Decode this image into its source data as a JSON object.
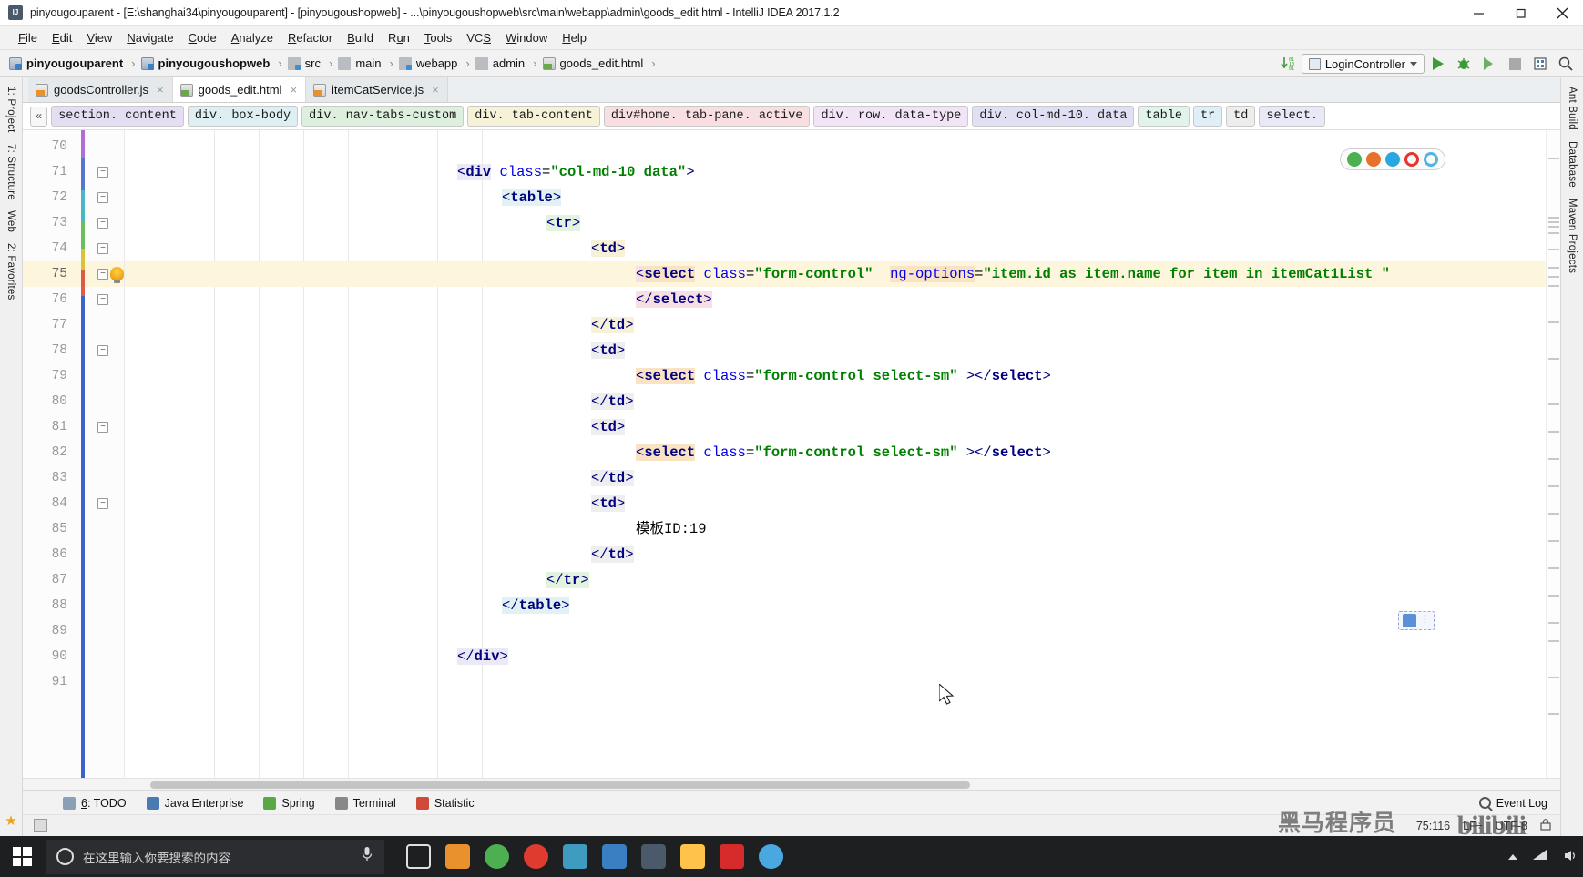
{
  "window": {
    "title": "pinyougouparent - [E:\\shanghai34\\pinyougouparent] - [pinyougoushopweb] - ...\\pinyougoushopweb\\src\\main\\webapp\\admin\\goods_edit.html - IntelliJ IDEA 2017.1.2",
    "app_icon": "intellij-idea-icon",
    "minimize_label": "─",
    "maximize_label": "❐",
    "close_label": "✕"
  },
  "menubar": {
    "items": [
      {
        "label": "File",
        "mnemonic": "F"
      },
      {
        "label": "Edit",
        "mnemonic": "E"
      },
      {
        "label": "View",
        "mnemonic": "V"
      },
      {
        "label": "Navigate",
        "mnemonic": "N"
      },
      {
        "label": "Code",
        "mnemonic": "C"
      },
      {
        "label": "Analyze",
        "mnemonic": "A"
      },
      {
        "label": "Refactor",
        "mnemonic": "R"
      },
      {
        "label": "Build",
        "mnemonic": "B"
      },
      {
        "label": "Run",
        "mnemonic": "u"
      },
      {
        "label": "Tools",
        "mnemonic": "T"
      },
      {
        "label": "VCS",
        "mnemonic": "S"
      },
      {
        "label": "Window",
        "mnemonic": "W"
      },
      {
        "label": "Help",
        "mnemonic": "H"
      }
    ]
  },
  "navbar": {
    "breadcrumbs": [
      {
        "label": "pinyougouparent",
        "icon": "module-icon",
        "bold": true
      },
      {
        "label": "pinyougoushopweb",
        "icon": "module-icon",
        "bold": true
      },
      {
        "label": "src",
        "icon": "source-folder-icon",
        "bold": false
      },
      {
        "label": "main",
        "icon": "folder-icon",
        "bold": false
      },
      {
        "label": "webapp",
        "icon": "web-folder-icon",
        "bold": false
      },
      {
        "label": "admin",
        "icon": "folder-icon",
        "bold": false
      },
      {
        "label": "goods_edit.html",
        "icon": "html-file-icon",
        "bold": false
      }
    ],
    "separator": "›",
    "run_config": "LoginController",
    "actions": [
      {
        "name": "update-project-icon",
        "label": "↓"
      },
      {
        "name": "run-button",
        "label": "Run"
      },
      {
        "name": "debug-button",
        "label": "Debug"
      },
      {
        "name": "run-coverage-button",
        "label": "Run with Coverage"
      },
      {
        "name": "stop-button",
        "label": "Stop"
      },
      {
        "name": "database-icon",
        "label": "Database"
      },
      {
        "name": "search-everywhere-icon",
        "label": "Search Everywhere"
      }
    ]
  },
  "editor_tabs": [
    {
      "label": "goodsController.js",
      "icon": "js-file-icon",
      "active": false,
      "close": "×"
    },
    {
      "label": "goods_edit.html",
      "icon": "html-file-icon",
      "active": true,
      "close": "×"
    },
    {
      "label": "itemCatService.js",
      "icon": "js-file-icon",
      "active": false,
      "close": "×"
    }
  ],
  "structure_breadcrumbs": {
    "collapse_label": "«",
    "chips": [
      {
        "label": "section. content",
        "color": "#e4def2"
      },
      {
        "label": "div. box-body",
        "color": "#ddeff2"
      },
      {
        "label": "div. nav-tabs-custom",
        "color": "#ddf0dd"
      },
      {
        "label": "div. tab-content",
        "color": "#f5f2d8"
      },
      {
        "label": "div#home. tab-pane. active",
        "color": "#f9dee2"
      },
      {
        "label": "div. row. data-type",
        "color": "#f2e4f7"
      },
      {
        "label": "div. col-md-10. data",
        "color": "#e0e0f4"
      },
      {
        "label": "table",
        "color": "#e1f4ec"
      },
      {
        "label": "tr",
        "color": "#dfeff7"
      },
      {
        "label": "td",
        "color": "#ededed"
      },
      {
        "label": "select.",
        "color": "#e8e8f6"
      }
    ]
  },
  "left_tool_strip": {
    "items": [
      {
        "label": "1: Project",
        "name": "tool-window-project"
      },
      {
        "label": "7: Structure",
        "name": "tool-window-structure"
      },
      {
        "label": "Web",
        "name": "tool-window-web"
      },
      {
        "label": "2: Favorites",
        "name": "tool-window-favorites"
      }
    ]
  },
  "right_tool_strip": {
    "items": [
      {
        "label": "Ant Build",
        "name": "tool-window-ant-build"
      },
      {
        "label": "Database",
        "name": "tool-window-database"
      },
      {
        "label": "Maven Projects",
        "name": "tool-window-maven-projects"
      }
    ]
  },
  "editor": {
    "first_line": 70,
    "highlighted_line": 75,
    "lines": [
      {
        "num": 70,
        "indent": 0,
        "tokens": []
      },
      {
        "num": 71,
        "indent": 0,
        "fold": "minus",
        "tokens": [
          {
            "t": "<",
            "c": "t-ang",
            "bg": "bg-f"
          },
          {
            "t": "div",
            "c": "t-tag",
            "bg": "bg-f"
          },
          {
            "t": " ",
            "c": "t-txt"
          },
          {
            "t": "class",
            "c": "t-attr"
          },
          {
            "t": "=",
            "c": "t-txt"
          },
          {
            "t": "\"col-md-10 data\"",
            "c": "t-val"
          },
          {
            "t": ">",
            "c": "t-ang"
          }
        ]
      },
      {
        "num": 72,
        "indent": 1,
        "fold": "minus",
        "tokens": [
          {
            "t": "<",
            "c": "t-ang",
            "bg": "bg-b"
          },
          {
            "t": "table",
            "c": "t-tag",
            "bg": "bg-b"
          },
          {
            "t": ">",
            "c": "t-ang",
            "bg": "bg-b"
          }
        ]
      },
      {
        "num": 73,
        "indent": 2,
        "fold": "minus",
        "tokens": [
          {
            "t": "<",
            "c": "t-ang",
            "bg": "bg-c"
          },
          {
            "t": "tr",
            "c": "t-tag",
            "bg": "bg-c"
          },
          {
            "t": ">",
            "c": "t-ang",
            "bg": "bg-c"
          }
        ]
      },
      {
        "num": 74,
        "indent": 3,
        "fold": "minus",
        "tokens": [
          {
            "t": "<",
            "c": "t-ang",
            "bg": "bg-d"
          },
          {
            "t": "td",
            "c": "t-tag",
            "bg": "bg-d"
          },
          {
            "t": ">",
            "c": "t-ang",
            "bg": "bg-d"
          }
        ]
      },
      {
        "num": 75,
        "indent": 4,
        "fold": "minus",
        "bulb": true,
        "tokens": [
          {
            "t": "<",
            "c": "t-ang",
            "bg": "bg-i"
          },
          {
            "t": "select",
            "c": "t-tag",
            "bg": "bg-h"
          },
          {
            "t": " ",
            "c": "t-txt"
          },
          {
            "t": "class",
            "c": "t-attr"
          },
          {
            "t": "=",
            "c": "t-txt"
          },
          {
            "t": "\"form-control\"",
            "c": "t-val"
          },
          {
            "t": "  ",
            "c": "t-txt"
          },
          {
            "t": "ng-options",
            "c": "t-attr",
            "bg": "bg-h"
          },
          {
            "t": "=",
            "c": "t-txt"
          },
          {
            "t": "\"item.id as item.name for item in itemCat1List \"",
            "c": "t-val"
          }
        ]
      },
      {
        "num": 76,
        "indent": 4,
        "fold": "minus",
        "tokens": [
          {
            "t": "</",
            "c": "t-ang",
            "bg": "bg-i"
          },
          {
            "t": "select",
            "c": "t-tag",
            "bg": "bg-i"
          },
          {
            "t": ">",
            "c": "t-ang",
            "bg": "bg-i"
          }
        ]
      },
      {
        "num": 77,
        "indent": 3,
        "tokens": [
          {
            "t": "</",
            "c": "t-ang",
            "bg": "bg-d"
          },
          {
            "t": "td",
            "c": "t-tag",
            "bg": "bg-d"
          },
          {
            "t": ">",
            "c": "t-ang",
            "bg": "bg-d"
          }
        ]
      },
      {
        "num": 78,
        "indent": 3,
        "fold": "minus",
        "tokens": [
          {
            "t": "<",
            "c": "t-ang",
            "bg": "bg-g"
          },
          {
            "t": "td",
            "c": "t-tag",
            "bg": "bg-g"
          },
          {
            "t": ">",
            "c": "t-ang",
            "bg": "bg-g"
          }
        ]
      },
      {
        "num": 79,
        "indent": 4,
        "tokens": [
          {
            "t": "<",
            "c": "t-ang",
            "bg": "bg-h"
          },
          {
            "t": "select",
            "c": "t-tag",
            "bg": "bg-h"
          },
          {
            "t": " ",
            "c": "t-txt"
          },
          {
            "t": "class",
            "c": "t-attr"
          },
          {
            "t": "=",
            "c": "t-txt"
          },
          {
            "t": "\"form-control select-sm\"",
            "c": "t-val"
          },
          {
            "t": " >",
            "c": "t-ang"
          },
          {
            "t": "</",
            "c": "t-ang"
          },
          {
            "t": "select",
            "c": "t-tag"
          },
          {
            "t": ">",
            "c": "t-ang"
          }
        ]
      },
      {
        "num": 80,
        "indent": 3,
        "tokens": [
          {
            "t": "</",
            "c": "t-ang",
            "bg": "bg-g"
          },
          {
            "t": "td",
            "c": "t-tag",
            "bg": "bg-g"
          },
          {
            "t": ">",
            "c": "t-ang",
            "bg": "bg-g"
          }
        ]
      },
      {
        "num": 81,
        "indent": 3,
        "fold": "minus",
        "tokens": [
          {
            "t": "<",
            "c": "t-ang",
            "bg": "bg-g"
          },
          {
            "t": "td",
            "c": "t-tag",
            "bg": "bg-g"
          },
          {
            "t": ">",
            "c": "t-ang",
            "bg": "bg-g"
          }
        ]
      },
      {
        "num": 82,
        "indent": 4,
        "tokens": [
          {
            "t": "<",
            "c": "t-ang",
            "bg": "bg-h"
          },
          {
            "t": "select",
            "c": "t-tag",
            "bg": "bg-h"
          },
          {
            "t": " ",
            "c": "t-txt"
          },
          {
            "t": "class",
            "c": "t-attr"
          },
          {
            "t": "=",
            "c": "t-txt"
          },
          {
            "t": "\"form-control select-sm\"",
            "c": "t-val"
          },
          {
            "t": " >",
            "c": "t-ang"
          },
          {
            "t": "</",
            "c": "t-ang"
          },
          {
            "t": "select",
            "c": "t-tag"
          },
          {
            "t": ">",
            "c": "t-ang"
          }
        ]
      },
      {
        "num": 83,
        "indent": 3,
        "tokens": [
          {
            "t": "</",
            "c": "t-ang",
            "bg": "bg-g"
          },
          {
            "t": "td",
            "c": "t-tag",
            "bg": "bg-g"
          },
          {
            "t": ">",
            "c": "t-ang",
            "bg": "bg-g"
          }
        ]
      },
      {
        "num": 84,
        "indent": 3,
        "fold": "minus",
        "tokens": [
          {
            "t": "<",
            "c": "t-ang",
            "bg": "bg-g"
          },
          {
            "t": "td",
            "c": "t-tag",
            "bg": "bg-g"
          },
          {
            "t": ">",
            "c": "t-ang",
            "bg": "bg-g"
          }
        ]
      },
      {
        "num": 85,
        "indent": 4,
        "tokens": [
          {
            "t": "模板ID:19",
            "c": "t-txt"
          }
        ]
      },
      {
        "num": 86,
        "indent": 3,
        "tokens": [
          {
            "t": "</",
            "c": "t-ang",
            "bg": "bg-g"
          },
          {
            "t": "td",
            "c": "t-tag",
            "bg": "bg-g"
          },
          {
            "t": ">",
            "c": "t-ang",
            "bg": "bg-g"
          }
        ]
      },
      {
        "num": 87,
        "indent": 2,
        "tokens": [
          {
            "t": "</",
            "c": "t-ang",
            "bg": "bg-c"
          },
          {
            "t": "tr",
            "c": "t-tag",
            "bg": "bg-c"
          },
          {
            "t": ">",
            "c": "t-ang",
            "bg": "bg-c"
          }
        ]
      },
      {
        "num": 88,
        "indent": 1,
        "tokens": [
          {
            "t": "</",
            "c": "t-ang",
            "bg": "bg-b"
          },
          {
            "t": "table",
            "c": "t-tag",
            "bg": "bg-b"
          },
          {
            "t": ">",
            "c": "t-ang",
            "bg": "bg-b"
          }
        ]
      },
      {
        "num": 89,
        "indent": 0,
        "tokens": []
      },
      {
        "num": 90,
        "indent": 0,
        "tokens": [
          {
            "t": "</",
            "c": "t-ang",
            "bg": "bg-f"
          },
          {
            "t": "div",
            "c": "t-tag",
            "bg": "bg-f"
          },
          {
            "t": ">",
            "c": "t-ang",
            "bg": "bg-f"
          }
        ]
      },
      {
        "num": 91,
        "indent": 0,
        "tokens": []
      }
    ],
    "browser_icons": [
      {
        "name": "chrome-icon",
        "color": "#4caf50"
      },
      {
        "name": "firefox-icon",
        "color": "#e8702a"
      },
      {
        "name": "safari-icon",
        "color": "#29a7e0"
      },
      {
        "name": "opera-icon",
        "color": "#e8342a"
      },
      {
        "name": "edge-icon",
        "color": "#4fb4e8"
      }
    ]
  },
  "bottom_tool_windows": [
    {
      "label": "6: TODO",
      "mnemonic": "6",
      "name": "tool-window-todo",
      "color": "#8aa0b4"
    },
    {
      "label": "Java Enterprise",
      "name": "tool-window-java-enterprise",
      "color": "#4a7ab0"
    },
    {
      "label": "Spring",
      "name": "tool-window-spring",
      "color": "#5aa844"
    },
    {
      "label": "Terminal",
      "name": "tool-window-terminal",
      "color": "#888888"
    },
    {
      "label": "Statistic",
      "name": "tool-window-statistic",
      "color": "#d04a3a"
    }
  ],
  "event_log": {
    "label": "Event Log",
    "icon": "magnifier-icon"
  },
  "statusbar": {
    "caret_position": "75:116",
    "line_separator": "LF÷",
    "encoding": "UTF-8",
    "lock_icon": "lock-icon",
    "watermark_cn": "黑马程序员",
    "watermark_brand": "bilibili"
  },
  "taskbar": {
    "start_label": "windows-start-icon",
    "search_placeholder": "在这里输入你要搜索的内容",
    "search_value": "",
    "items": [
      {
        "name": "cortana-icon",
        "color": "#ffffff"
      },
      {
        "name": "task-view-icon",
        "color": "#ffffff"
      },
      {
        "name": "app-orange-icon",
        "color": "#e8912d"
      },
      {
        "name": "chrome-icon",
        "color": "#4caf50"
      },
      {
        "name": "app-red-icon",
        "color": "#e03b2f"
      },
      {
        "name": "app-teal-icon",
        "color": "#3f9bbf"
      },
      {
        "name": "app-blue-icon",
        "color": "#3a7fc1"
      },
      {
        "name": "intellij-idea-icon",
        "color": "#4a5a6a"
      },
      {
        "name": "file-explorer-icon",
        "color": "#ffc24a"
      },
      {
        "name": "pdf-reader-icon",
        "color": "#d62b2b"
      },
      {
        "name": "app-lightblue-icon",
        "color": "#4aa8e0"
      }
    ],
    "tray": {
      "expand": "˄",
      "network_icon": "network-icon",
      "volume_icon": "volume-icon"
    }
  }
}
